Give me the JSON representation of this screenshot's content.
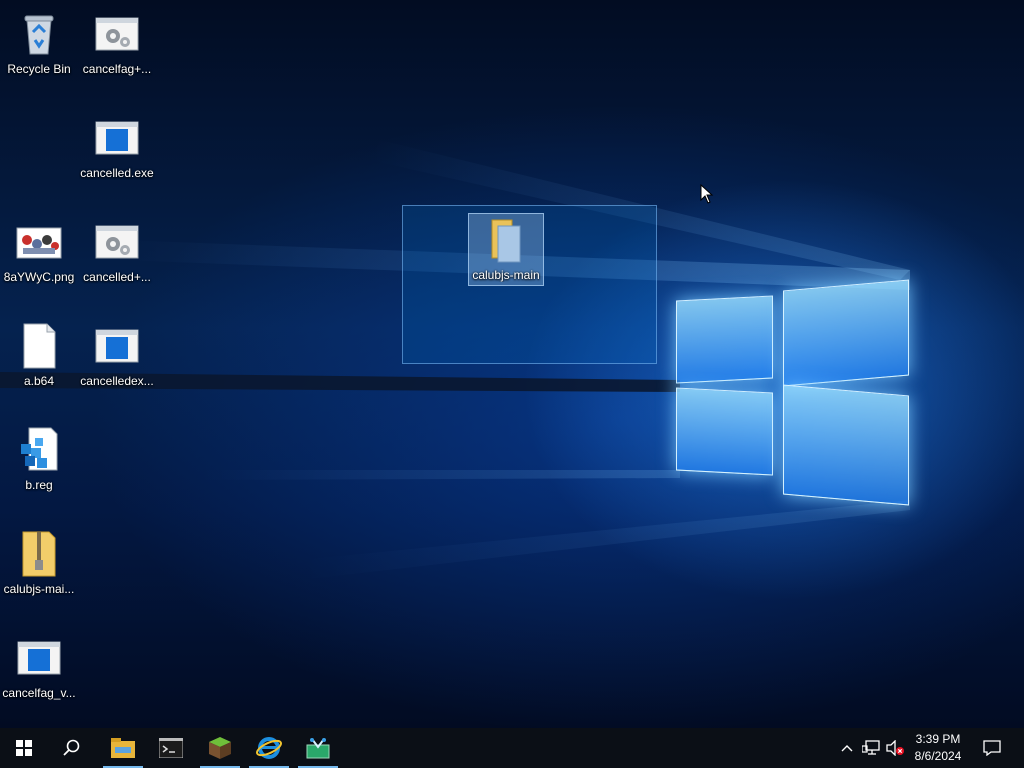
{
  "desktop": {
    "icons": [
      {
        "label": "Recycle Bin",
        "icon": "recycle-bin-icon"
      },
      {
        "label": "cancelfag+...",
        "icon": "exe-gears-icon"
      },
      {
        "label": "cancelled.exe",
        "icon": "exe-window-icon"
      },
      {
        "label": "8aYWyC.png",
        "icon": "image-file-icon"
      },
      {
        "label": "cancelled+...",
        "icon": "exe-gears-icon"
      },
      {
        "label": "a.b64",
        "icon": "blank-file-icon"
      },
      {
        "label": "cancelledex...",
        "icon": "exe-window-icon"
      },
      {
        "label": "b.reg",
        "icon": "registry-file-icon"
      },
      {
        "label": "calubjs-mai...",
        "icon": "zip-folder-icon"
      },
      {
        "label": "cancelfag_v...",
        "icon": "exe-window-icon"
      }
    ],
    "dragged_item": {
      "label": "calubjs-main",
      "icon": "folder-icon"
    }
  },
  "taskbar": {
    "start": "start-icon",
    "search": "search-icon",
    "apps": [
      {
        "name": "File Explorer",
        "icon": "file-explorer-icon"
      },
      {
        "name": "Command Prompt",
        "icon": "command-prompt-icon"
      },
      {
        "name": "Minecraft",
        "icon": "minecraft-icon"
      },
      {
        "name": "Internet Explorer",
        "icon": "internet-explorer-icon"
      },
      {
        "name": "Snipping Tool",
        "icon": "snipping-tool-icon"
      }
    ],
    "tray": {
      "time": "3:39 PM",
      "date": "8/6/2024"
    }
  },
  "colors": {
    "accent": "#0078d7",
    "taskbar": "#0b0f16",
    "active_indicator": "#76b9ed"
  }
}
